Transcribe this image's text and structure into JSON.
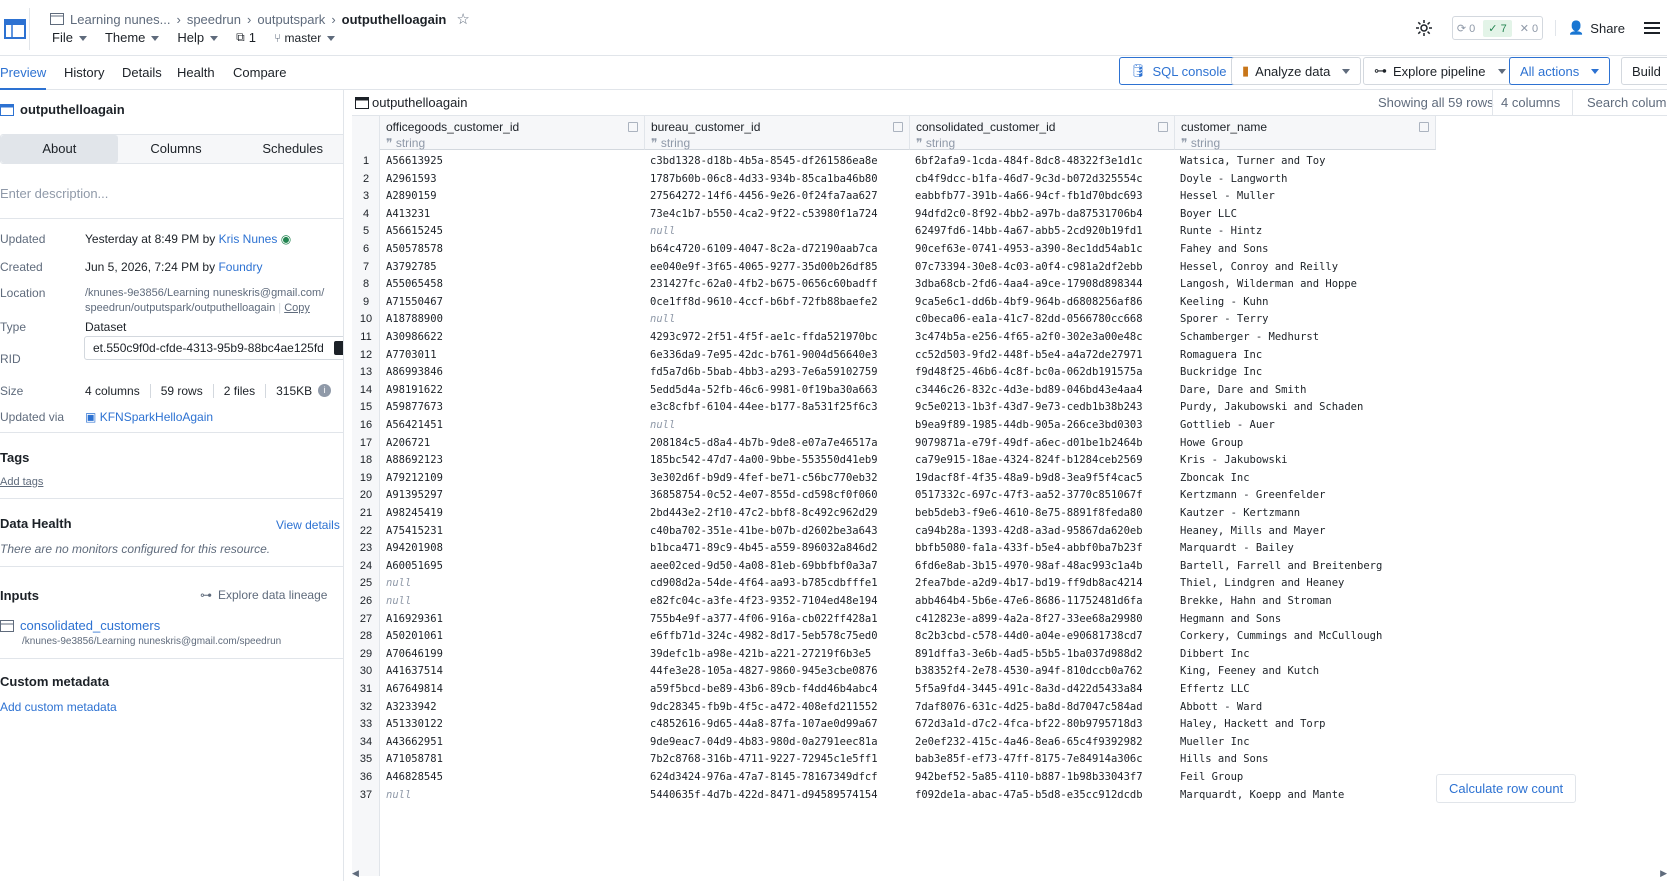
{
  "header": {
    "breadcrumbs": [
      "Learning nunes...",
      "speedrun",
      "outputspark",
      "outputhelloagain"
    ],
    "menus": [
      "File",
      "Theme",
      "Help"
    ],
    "branch_count": "1",
    "branch": "master",
    "checks": {
      "pending": "0",
      "passed": "7",
      "failed": "0"
    },
    "share_label": "Share"
  },
  "tabs": [
    "Preview",
    "History",
    "Details",
    "Health",
    "Compare"
  ],
  "actions": {
    "sql": "SQL console",
    "analyze": "Analyze data",
    "explore": "Explore pipeline",
    "all": "All actions",
    "build": "Build"
  },
  "left": {
    "dataset_name": "outputhelloagain",
    "segments": [
      "About",
      "Columns",
      "Schedules"
    ],
    "description_placeholder": "Enter description...",
    "props": {
      "updated_label": "Updated",
      "updated_value": "Yesterday at 8:49 PM by",
      "updated_by": "Kris Nunes",
      "created_label": "Created",
      "created_value": "Jun 5, 2026, 7:24 PM by",
      "created_by": "Foundry",
      "location_label": "Location",
      "location_line1": "/knunes-9e3856/Learning nuneskris@gmail.com/",
      "location_line2": "speedrun/outputspark/outputhelloagain",
      "copy": "Copy",
      "type_label": "Type",
      "type_value": "Dataset",
      "rid_label": "RID",
      "rid_value": "et.550c9f0d-cfde-4313-95b9-88bc4ae125fd",
      "size_label": "Size",
      "size_cols": "4 columns",
      "size_rows": "59 rows",
      "size_files": "2 files",
      "size_kb": "315KB",
      "via_label": "Updated via",
      "via_value": "KFNSparkHelloAgain"
    },
    "tags_title": "Tags",
    "add_tags": "Add tags",
    "health_title": "Data Health",
    "view_details": "View details",
    "health_msg": "There are no monitors configured for this resource.",
    "inputs_title": "Inputs",
    "lineage": "Explore data lineage",
    "input_name": "consolidated_customers",
    "input_path": "/knunes-9e3856/Learning nuneskris@gmail.com/speedrun",
    "custom_title": "Custom metadata",
    "add_custom": "Add custom metadata"
  },
  "table": {
    "title": "outputhelloagain",
    "showing": "Showing all 59 rows",
    "cols_count": "4 columns",
    "search_placeholder": "Search columns...",
    "calc": "Calculate row count",
    "columns": [
      {
        "name": "officegoods_customer_id",
        "type": "string"
      },
      {
        "name": "bureau_customer_id",
        "type": "string"
      },
      {
        "name": "consolidated_customer_id",
        "type": "string"
      },
      {
        "name": "customer_name",
        "type": "string"
      }
    ],
    "rows": [
      [
        "A56613925",
        "c3bd1328-d18b-4b5a-8545-df261586ea8e",
        "6bf2afa9-1cda-484f-8dc8-48322f3e1d1c",
        "Watsica, Turner and Toy"
      ],
      [
        "A2961593",
        "1787b60b-06c8-4d33-934b-85ca1ba46b80",
        "cb4f9dcc-b1fa-46d7-9c3d-b072d325554c",
        "Doyle - Langworth"
      ],
      [
        "A2890159",
        "27564272-14f6-4456-9e26-0f24fa7aa627",
        "eabbfb77-391b-4a66-94cf-fb1d70bdc693",
        "Hessel - Muller"
      ],
      [
        "A413231",
        "73e4c1b7-b550-4ca2-9f22-c53980f1a724",
        "94dfd2c0-8f92-4bb2-a97b-da87531706b4",
        "Boyer LLC"
      ],
      [
        "A56615245",
        "null",
        "62497fd6-14bb-4a67-abb5-2cd920b19fd1",
        "Runte - Hintz"
      ],
      [
        "A50578578",
        "b64c4720-6109-4047-8c2a-d72190aab7ca",
        "90cef63e-0741-4953-a390-8ec1dd54ab1c",
        "Fahey and Sons"
      ],
      [
        "A3792785",
        "ee040e9f-3f65-4065-9277-35d00b26df85",
        "07c73394-30e8-4c03-a0f4-c981a2df2ebb",
        "Hessel, Conroy and Reilly"
      ],
      [
        "A55065458",
        "231427fc-62a0-4fb2-b675-0656c60badff",
        "3dba68cb-2fd6-4aa4-a9ce-17908d898344",
        "Langosh, Wilderman and Hoppe"
      ],
      [
        "A71550467",
        "0ce1ff8d-9610-4ccf-b6bf-72fb88baefe2",
        "9ca5e6c1-dd6b-4bf9-964b-d6808256af86",
        "Keeling - Kuhn"
      ],
      [
        "A18788900",
        "null",
        "c0beca06-ea1a-41c7-82dd-0566780cc668",
        "Sporer - Terry"
      ],
      [
        "A30986622",
        "4293c972-2f51-4f5f-ae1c-ffda521970bc",
        "3c474b5a-e256-4f65-a2f0-302e3a00e48c",
        "Schamberger - Medhurst"
      ],
      [
        "A7703011",
        "6e336da9-7e95-42dc-b761-9004d56640e3",
        "cc52d503-9fd2-448f-b5e4-a4a72de27971",
        "Romaguera Inc"
      ],
      [
        "A86993846",
        "fd5a7d6b-5bab-4bb3-a293-7e6a59102759",
        "f9d48f25-46b6-4c8f-bc0a-062db191575a",
        "Buckridge Inc"
      ],
      [
        "A98191622",
        "5edd5d4a-52fb-46c6-9981-0f19ba30a663",
        "c3446c26-832c-4d3e-bd89-046bd43e4aa4",
        "Dare, Dare and Smith"
      ],
      [
        "A59877673",
        "e3c8cfbf-6104-44ee-b177-8a531f25f6c3",
        "9c5e0213-1b3f-43d7-9e73-cedb1b38b243",
        "Purdy, Jakubowski and Schaden"
      ],
      [
        "A56421451",
        "null",
        "b9ea9f89-1985-44db-905a-266ce3bd0303",
        "Gottlieb - Auer"
      ],
      [
        "A206721",
        "208184c5-d8a4-4b7b-9de8-e07a7e46517a",
        "9079871a-e79f-49df-a6ec-d01be1b2464b",
        "Howe Group"
      ],
      [
        "A88692123",
        "185bc542-47d7-4a00-9bbe-553550d41eb9",
        "ca79e915-18ae-4324-824f-b1284ceb2569",
        "Kris - Jakubowski"
      ],
      [
        "A79212109",
        "3e302d6f-b9d9-4fef-be71-c56bc770eb32",
        "19dacf8f-4f35-48a9-b9d8-3ea9f5f4cac5",
        "Zboncak Inc"
      ],
      [
        "A91395297",
        "36858754-0c52-4e07-855d-cd598cf0f060",
        "0517332c-697c-47f3-aa52-3770c851067f",
        "Kertzmann - Greenfelder"
      ],
      [
        "A98245419",
        "2bd443e2-2f10-47c2-bbf8-8c492c962d29",
        "beb5deb3-f9e6-4610-8e75-8891f8feda80",
        "Kautzer - Kertzmann"
      ],
      [
        "A75415231",
        "c40ba702-351e-41be-b07b-d2602be3a643",
        "ca94b28a-1393-42d8-a3ad-95867da620eb",
        "Heaney, Mills and Mayer"
      ],
      [
        "A94201908",
        "b1bca471-89c9-4b45-a559-896032a846d2",
        "bbfb5080-fa1a-433f-b5e4-abbf0ba7b23f",
        "Marquardt - Bailey"
      ],
      [
        "A60051695",
        "aee02ced-9d50-4a08-81eb-69bbfbf0a3a7",
        "6fd6e8ab-3b15-4970-98af-48ac993c1a4b",
        "Bartell, Farrell and Breitenberg"
      ],
      [
        "null",
        "cd908d2a-54de-4f64-aa93-b785cdbfffe1",
        "2fea7bde-a2d9-4b17-bd19-ff9db8ac4214",
        "Thiel, Lindgren and Heaney"
      ],
      [
        "null",
        "e82fc04c-a3fe-4f23-9352-7104ed48e194",
        "abb464b4-5b6e-47e6-8686-11752481d6fa",
        "Brekke, Hahn and Stroman"
      ],
      [
        "A16929361",
        "755b4e9f-a377-4f06-916a-cb022ff428a1",
        "c412823e-a899-4a2a-8f27-33ee68a29980",
        "Hegmann and Sons"
      ],
      [
        "A50201061",
        "e6ffb71d-324c-4982-8d17-5eb578c75ed0",
        "8c2b3cbd-c578-44d0-a04e-e90681738cd7",
        "Corkery, Cummings and McCullough"
      ],
      [
        "A70646199",
        "39defc1b-a98e-421b-a221-27219f6b3e5",
        "891dffa3-3e6b-4ad5-b5b5-1ba037d988d2",
        "Dibbert Inc"
      ],
      [
        "A41637514",
        "44fe3e28-105a-4827-9860-945e3cbe0876",
        "b38352f4-2e78-4530-a94f-810dccb0a762",
        "King, Feeney and Kutch"
      ],
      [
        "A67649814",
        "a59f5bcd-be89-43b6-89cb-f4dd46b4abc4",
        "5f5a9fd4-3445-491c-8a3d-d422d5433a84",
        "Effertz LLC"
      ],
      [
        "A3233942",
        "9dc28345-fb9b-4f5c-a472-408efd211552",
        "7daf8076-631c-4d25-ba8d-8d7047c584ad",
        "Abbott - Ward"
      ],
      [
        "A51330122",
        "c4852616-9d65-44a8-87fa-107ae0d99a67",
        "672d3a1d-d7c2-4fca-bf22-80b9795718d3",
        "Haley, Hackett and Torp"
      ],
      [
        "A43662951",
        "9de9eac7-04d9-4b83-980d-0a2791eec81a",
        "2e0ef232-415c-4a46-8ea6-65c4f9392982",
        "Mueller Inc"
      ],
      [
        "A71058781",
        "7b2c8768-316b-4711-9227-72945c1e5ff1",
        "bab3e85f-ef73-47ff-8175-7e84914a306c",
        "Hills and Sons"
      ],
      [
        "A46828545",
        "624d3424-976a-47a7-8145-78167349dfcf",
        "942bef52-5a85-4110-b887-1b98b33043f7",
        "Feil Group"
      ],
      [
        "null",
        "5440635f-4d7b-422d-8471-d94589574154",
        "f092de1a-abac-47a5-b5d8-e35cc912dcdb",
        "Marquardt, Koepp and Mante"
      ]
    ]
  }
}
